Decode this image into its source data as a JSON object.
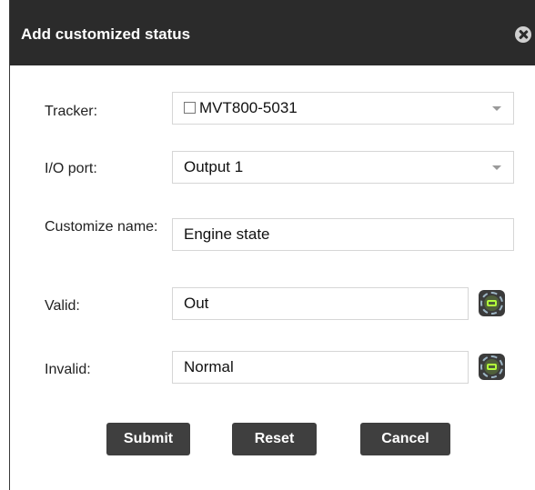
{
  "dialog": {
    "title": "Add customized status"
  },
  "form": {
    "tracker": {
      "label": "Tracker:",
      "value": "MVT800-5031"
    },
    "io_port": {
      "label": "I/O port:",
      "value": "Output 1"
    },
    "customize_name": {
      "label": "Customize name:",
      "value": "Engine state"
    },
    "valid": {
      "label": "Valid:",
      "value": "Out",
      "icon": "engine-icon"
    },
    "invalid": {
      "label": "Invalid:",
      "value": "Normal",
      "icon": "engine-icon"
    }
  },
  "buttons": {
    "submit": "Submit",
    "reset": "Reset",
    "cancel": "Cancel"
  },
  "colors": {
    "titlebar": "#2b2b2b",
    "button": "#3f3f3f",
    "icon_accent": "#b3ff3b"
  }
}
